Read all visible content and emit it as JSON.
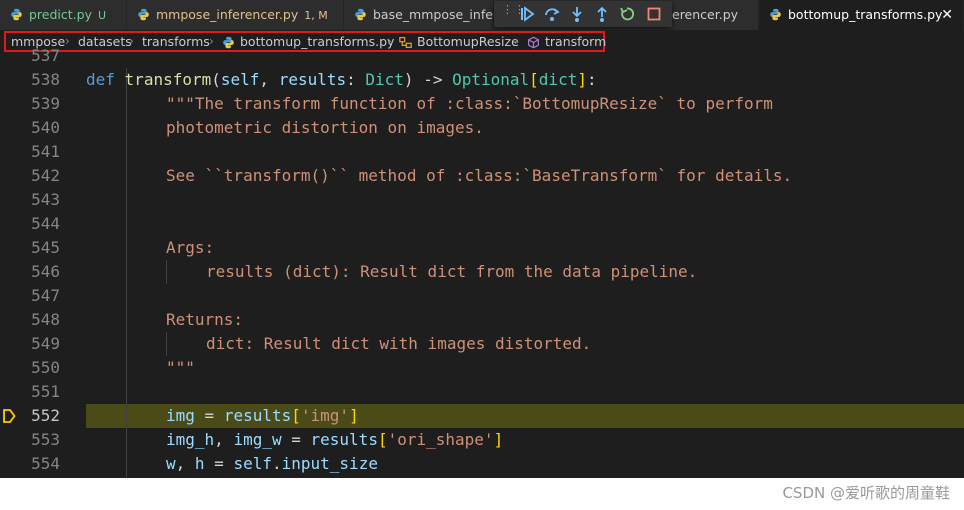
{
  "tabs": [
    {
      "label": "predict.py",
      "status": "U",
      "status_color": "#73c991",
      "label_color": "#73c991"
    },
    {
      "label": "mmpose_inferencer.py",
      "status": "1, M",
      "status_color": "#e2c08d",
      "label_color": "#e2c08d"
    },
    {
      "label": "base_mmpose_infer",
      "status": "",
      "status_color": "",
      "label_color": "#cccccc"
    },
    {
      "label": "erencer.py",
      "status": "",
      "status_color": "",
      "label_color": "#cccccc"
    },
    {
      "label": "bottomup_transforms.py",
      "status": "",
      "status_color": "",
      "label_color": "#ffffff"
    }
  ],
  "debug_toolbar": [
    "continue",
    "step-over",
    "step-into",
    "step-out",
    "restart",
    "stop"
  ],
  "breadcrumb": {
    "items": [
      "mmpose",
      "datasets",
      "transforms",
      "bottomup_transforms.py",
      "BottomupResize",
      "transform"
    ]
  },
  "code_lines": [
    {
      "num": "537",
      "text": ""
    },
    {
      "num": "538",
      "text": "def transform(self, results: Dict) -> Optional[dict]:"
    },
    {
      "num": "539",
      "text": "\"\"\"The transform function of :class:`BottomupResize` to perform"
    },
    {
      "num": "540",
      "text": "photometric distortion on images."
    },
    {
      "num": "541",
      "text": ""
    },
    {
      "num": "542",
      "text": "See ``transform()`` method of :class:`BaseTransform` for details."
    },
    {
      "num": "543",
      "text": ""
    },
    {
      "num": "544",
      "text": ""
    },
    {
      "num": "545",
      "text": "Args:"
    },
    {
      "num": "546",
      "text": "results (dict): Result dict from the data pipeline."
    },
    {
      "num": "547",
      "text": ""
    },
    {
      "num": "548",
      "text": "Returns:"
    },
    {
      "num": "549",
      "text": "dict: Result dict with images distorted."
    },
    {
      "num": "550",
      "text": "\"\"\""
    },
    {
      "num": "551",
      "text": ""
    },
    {
      "num": "552",
      "text": "img = results['img']"
    },
    {
      "num": "553",
      "text": "img_h, img_w = results['ori_shape']"
    },
    {
      "num": "554",
      "text": "w, h = self.input_size"
    }
  ],
  "current_line": "552",
  "watermark": "CSDN @爱听歌的周童鞋",
  "colors": {
    "editor_bg": "#1e1e1e",
    "current_line_bg": "#4b4b18",
    "breadcrumb_outline": "#e0191b"
  }
}
